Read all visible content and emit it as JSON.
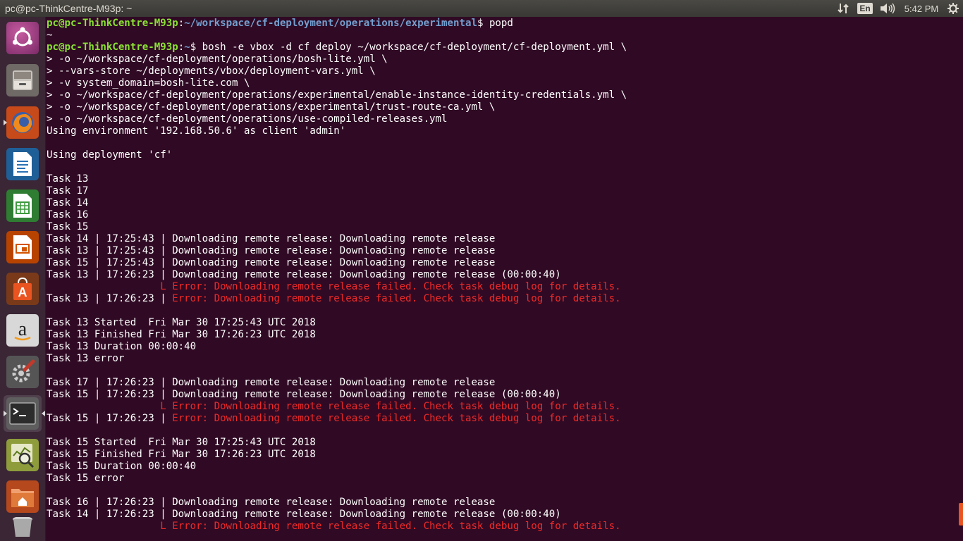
{
  "topbar": {
    "window_title": "pc@pc-ThinkCentre-M93p: ~",
    "keyboard_layout": "En",
    "clock": "5:42 PM",
    "icons": [
      "network-updown-icon",
      "keyboard-icon",
      "volume-icon",
      "gear-icon"
    ]
  },
  "launcher": {
    "items": [
      {
        "name": "ubuntu-dash-icon",
        "color": "#e95420"
      },
      {
        "name": "files-icon",
        "color": "#9a9a9a"
      },
      {
        "name": "firefox-icon",
        "color": "#e66000"
      },
      {
        "name": "libreoffice-writer-icon",
        "color": "#2a72b5"
      },
      {
        "name": "libreoffice-calc-icon",
        "color": "#3c9a3c"
      },
      {
        "name": "libreoffice-impress-icon",
        "color": "#d35400"
      },
      {
        "name": "ubuntu-software-icon",
        "color": "#e95420"
      },
      {
        "name": "amazon-icon",
        "color": "#e8e8e8"
      },
      {
        "name": "system-settings-icon",
        "color": "#7a7a7a"
      },
      {
        "name": "terminal-icon",
        "color": "#2c2c2c"
      },
      {
        "name": "system-monitor-icon",
        "color": "#a6b84a"
      },
      {
        "name": "home-folder-icon",
        "color": "#e07a3a"
      },
      {
        "name": "trash-icon",
        "color": "#999999"
      }
    ]
  },
  "terminal": {
    "lines": [
      {
        "user": "pc@pc-ThinkCentre-M93p",
        "path": "~/workspace/cf-deployment/operations/experimental",
        "cmd": "$ popd"
      },
      {
        "text": "~"
      },
      {
        "user": "pc@pc-ThinkCentre-M93p",
        "path": "~",
        "cmd": "$ bosh -e vbox -d cf deploy ~/workspace/cf-deployment/cf-deployment.yml \\"
      },
      {
        "text": "> -o ~/workspace/cf-deployment/operations/bosh-lite.yml \\"
      },
      {
        "text": "> --vars-store ~/deployments/vbox/deployment-vars.yml \\"
      },
      {
        "text": "> -v system_domain=bosh-lite.com \\"
      },
      {
        "text": "> -o ~/workspace/cf-deployment/operations/experimental/enable-instance-identity-credentials.yml \\"
      },
      {
        "text": "> -o ~/workspace/cf-deployment/operations/experimental/trust-route-ca.yml \\"
      },
      {
        "text": "> -o ~/workspace/cf-deployment/operations/use-compiled-releases.yml"
      },
      {
        "text": "Using environment '192.168.50.6' as client 'admin'"
      },
      {
        "text": ""
      },
      {
        "text": "Using deployment 'cf'"
      },
      {
        "text": ""
      },
      {
        "text": "Task 13"
      },
      {
        "text": "Task 17"
      },
      {
        "text": "Task 14"
      },
      {
        "text": "Task 16"
      },
      {
        "text": "Task 15"
      },
      {
        "text": "Task 14 | 17:25:43 | Downloading remote release: Downloading remote release"
      },
      {
        "text": "Task 13 | 17:25:43 | Downloading remote release: Downloading remote release"
      },
      {
        "text": "Task 15 | 17:25:43 | Downloading remote release: Downloading remote release"
      },
      {
        "text": "Task 13 | 17:26:23 | Downloading remote release: Downloading remote release (00:00:40)"
      },
      {
        "text": "",
        "error": "                   L Error: Downloading remote release failed. Check task debug log for details."
      },
      {
        "text": "Task 13 | 17:26:23 | ",
        "error": "Error: Downloading remote release failed. Check task debug log for details."
      },
      {
        "text": ""
      },
      {
        "text": "Task 13 Started  Fri Mar 30 17:25:43 UTC 2018"
      },
      {
        "text": "Task 13 Finished Fri Mar 30 17:26:23 UTC 2018"
      },
      {
        "text": "Task 13 Duration 00:00:40"
      },
      {
        "text": "Task 13 error"
      },
      {
        "text": ""
      },
      {
        "text": "Task 17 | 17:26:23 | Downloading remote release: Downloading remote release"
      },
      {
        "text": "Task 15 | 17:26:23 | Downloading remote release: Downloading remote release (00:00:40)"
      },
      {
        "text": "",
        "error": "                   L Error: Downloading remote release failed. Check task debug log for details."
      },
      {
        "text": "Task 15 | 17:26:23 | ",
        "error": "Error: Downloading remote release failed. Check task debug log for details."
      },
      {
        "text": ""
      },
      {
        "text": "Task 15 Started  Fri Mar 30 17:25:43 UTC 2018"
      },
      {
        "text": "Task 15 Finished Fri Mar 30 17:26:23 UTC 2018"
      },
      {
        "text": "Task 15 Duration 00:00:40"
      },
      {
        "text": "Task 15 error"
      },
      {
        "text": ""
      },
      {
        "text": "Task 16 | 17:26:23 | Downloading remote release: Downloading remote release"
      },
      {
        "text": "Task 14 | 17:26:23 | Downloading remote release: Downloading remote release (00:00:40)"
      },
      {
        "text": "",
        "error": "                   L Error: Downloading remote release failed. Check task debug log for details."
      }
    ]
  },
  "colors": {
    "terminal_bg": "#300a24",
    "prompt_user": "#8ae234",
    "prompt_path": "#729fcf",
    "error": "#ef2929",
    "scroll_thumb": "#e95420"
  }
}
